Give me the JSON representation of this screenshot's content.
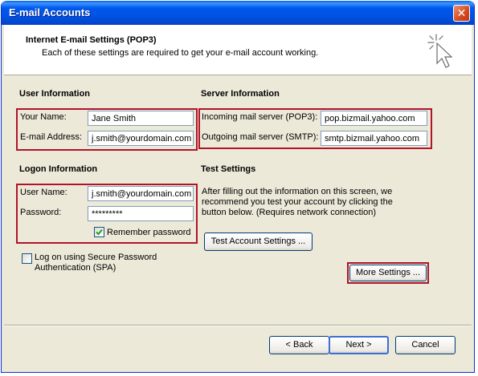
{
  "window": {
    "title": "E-mail Accounts",
    "close_glyph": "✕"
  },
  "header": {
    "title": "Internet E-mail Settings (POP3)",
    "subtitle": "Each of these settings are required to get your e-mail account working.",
    "icon": "wizard-cursor-icon"
  },
  "user_info": {
    "heading": "User Information",
    "name_label": "Your Name:",
    "name_value": "Jane Smith",
    "email_label": "E-mail Address:",
    "email_value": "j.smith@yourdomain.com"
  },
  "server_info": {
    "heading": "Server Information",
    "incoming_label": "Incoming mail server (POP3):",
    "incoming_value": "pop.bizmail.yahoo.com",
    "outgoing_label": "Outgoing mail server (SMTP):",
    "outgoing_value": "smtp.bizmail.yahoo.com"
  },
  "logon_info": {
    "heading": "Logon Information",
    "username_label": "User Name:",
    "username_value": "j.smith@yourdomain.com",
    "password_label": "Password:",
    "password_value": "*********",
    "remember_label": "Remember password",
    "remember_checked": true,
    "spa_label_line1": "Log on using Secure Password",
    "spa_label_line2": "Authentication (SPA)",
    "spa_checked": false
  },
  "test_settings": {
    "heading": "Test Settings",
    "description_line1": "After filling out the information on this screen, we",
    "description_line2": "recommend you test your account by clicking the",
    "description_line3": "button below. (Requires network connection)",
    "test_button": "Test Account Settings ...",
    "more_button": "More Settings ..."
  },
  "footer": {
    "back": "< Back",
    "next": "Next >",
    "cancel": "Cancel"
  },
  "colors": {
    "highlight": "#b0142a",
    "titlebar": "#0054e3",
    "dialog_bg": "#ece9d8"
  }
}
